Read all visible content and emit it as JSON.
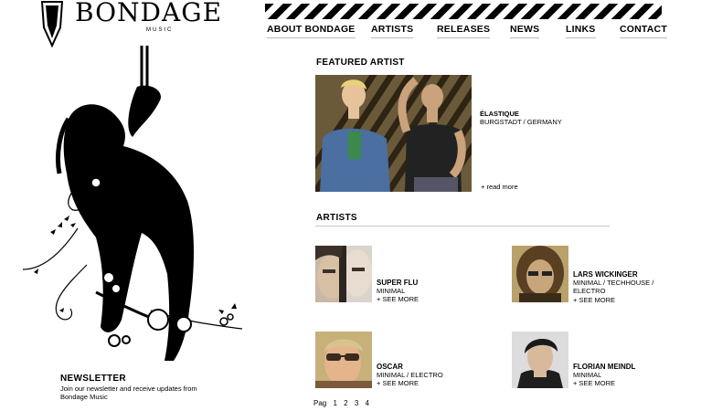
{
  "logo": {
    "text": "BONDAGE",
    "sub": "MUSIC"
  },
  "nav": {
    "items": [
      "ABOUT BONDAGE",
      "ARTISTS",
      "RELEASES",
      "NEWS",
      "LINKS",
      "CONTACT"
    ]
  },
  "featured": {
    "title": "FEATURED ARTIST",
    "name": "ÉLASTIQUE",
    "location": "BURGSTADT / GERMANY",
    "more": "+ read more"
  },
  "artists": {
    "title": "ARTISTS",
    "items": [
      {
        "name": "SUPER FLU",
        "genre": "MINIMAL",
        "more": "+ SEE MORE"
      },
      {
        "name": "LARS WICKINGER",
        "genre": "MINIMAL / TECHHOUSE / ELECTRO",
        "more": "+ SEE MORE"
      },
      {
        "name": "OSCAR",
        "genre": "MINIMAL / ELECTRO",
        "more": "+ SEE MORE"
      },
      {
        "name": "FLORIAN MEINDL",
        "genre": "MINIMAL",
        "more": "+ SEE MORE"
      }
    ]
  },
  "pager": {
    "label": "Pag",
    "pages": [
      "1",
      "2",
      "3",
      "4"
    ]
  },
  "newsletter": {
    "title": "NEWSLETTER",
    "text": "Join our newsletter and receive updates from Bondage Music"
  }
}
